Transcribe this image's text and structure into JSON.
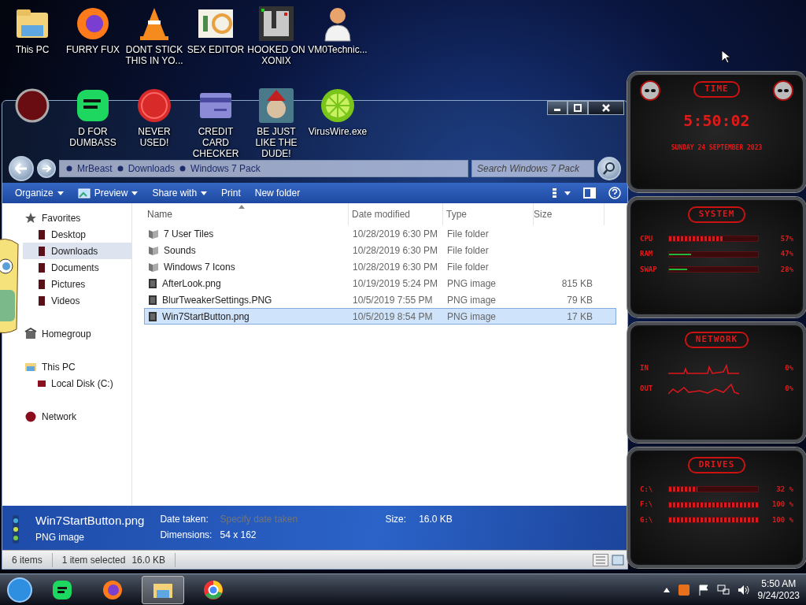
{
  "desktop_icons": [
    {
      "label": "This PC"
    },
    {
      "label": "FURRY FUX"
    },
    {
      "label": "DONT STICK THIS IN YO..."
    },
    {
      "label": "SEX EDITOR"
    },
    {
      "label": "HOOKED ON XONIX"
    },
    {
      "label": "VM0Technic..."
    },
    {
      "label": "D FOR DUMBASS"
    },
    {
      "label": "NEVER USED!"
    },
    {
      "label": "CREDIT CARD CHECKER"
    },
    {
      "label": "BE JUST LIKE THE DUDE!"
    },
    {
      "label": "VirusWire.exe"
    }
  ],
  "explorer": {
    "breadcrumb": [
      "MrBeast",
      "Downloads",
      "Windows 7 Pack"
    ],
    "search": {
      "placeholder": "Search Windows 7 Pack"
    },
    "toolbar": [
      {
        "label": "Organize",
        "dropdown": true
      },
      {
        "label": "Preview",
        "dropdown": true
      },
      {
        "label": "Share with",
        "dropdown": true
      },
      {
        "label": "Print",
        "dropdown": false
      },
      {
        "label": "New folder",
        "dropdown": false
      }
    ],
    "nav": [
      {
        "label": "Favorites",
        "selected": false,
        "children": [
          {
            "label": "Desktop",
            "selected": false
          },
          {
            "label": "Downloads",
            "selected": true
          },
          {
            "label": "Documents",
            "selected": false
          },
          {
            "label": "Pictures",
            "selected": false
          },
          {
            "label": "Videos",
            "selected": false
          }
        ]
      },
      {
        "label": "Homegroup",
        "selected": false
      },
      {
        "label": "This PC",
        "selected": false,
        "children": [
          {
            "label": "Local Disk (C:)",
            "selected": false
          }
        ]
      },
      {
        "label": "Network",
        "selected": false
      }
    ],
    "columns": [
      {
        "label": "Name",
        "sorted": true
      },
      {
        "label": "Date modified",
        "sorted": false
      },
      {
        "label": "Type",
        "sorted": false
      },
      {
        "label": "Size",
        "sorted": false
      }
    ],
    "rows": [
      {
        "kind": "folder",
        "name": "7 User Tiles",
        "date": "10/28/2019 6:30 PM",
        "type": "File folder",
        "selected": false
      },
      {
        "kind": "folder",
        "name": "Sounds",
        "date": "10/28/2019 6:30 PM",
        "type": "File folder",
        "selected": false
      },
      {
        "kind": "folder",
        "name": "Windows 7 Icons",
        "date": "10/28/2019 6:30 PM",
        "type": "File folder",
        "selected": false
      },
      {
        "kind": "file",
        "name": "AfterLook.png",
        "date": "10/19/2019 5:24 PM",
        "type": "PNG image",
        "size": "815 KB",
        "selected": false
      },
      {
        "kind": "file",
        "name": "BlurTweakerSettings.PNG",
        "date": "10/5/2019 7:55 PM",
        "type": "PNG image",
        "size": "79 KB",
        "selected": false
      },
      {
        "kind": "file",
        "name": "Win7StartButton.png",
        "date": "10/5/2019 8:54 PM",
        "type": "PNG image",
        "size": "17 KB",
        "selected": true
      }
    ],
    "details": {
      "name": "Win7StartButton.png",
      "type": "PNG image",
      "date_label": "Date taken:",
      "date_placeholder": "Specify date taken",
      "dim_label": "Dimensions:",
      "dimensions": "54 x 162",
      "size_label": "Size:",
      "size": "16.0 KB"
    },
    "status": {
      "items": "6 items",
      "selected": "1 item selected",
      "selected_size": "16.0 KB"
    }
  },
  "widget": {
    "time": {
      "title": "TIME",
      "clock": "5:50:02",
      "date": "SUNDAY 24 SEPTEMBER 2023"
    },
    "system": {
      "title": "SYSTEM",
      "meters": [
        {
          "label": "CPU",
          "level": 0.6,
          "reading": "57%",
          "color": "#e0161b"
        },
        {
          "label": "RAM",
          "level": 0.25,
          "reading": "47%",
          "color": "#1fb83a"
        },
        {
          "label": "SWAP",
          "level": 0.2,
          "reading": "28%",
          "color": "#1fb83a"
        }
      ]
    },
    "network": {
      "title": "NETWORK",
      "rows": [
        {
          "label": "IN",
          "reading": "0%"
        },
        {
          "label": "OUT",
          "reading": "0%"
        }
      ]
    },
    "drives": {
      "title": "DRIVES",
      "meters": [
        {
          "label": "C:\\",
          "level": 0.32,
          "reading": "32 %"
        },
        {
          "label": "F:\\",
          "level": 1,
          "reading": "100 %"
        },
        {
          "label": "G:\\",
          "level": 1,
          "reading": "100 %"
        }
      ]
    }
  },
  "taskbar": {
    "apps": [
      {
        "selected": false
      },
      {
        "selected": false
      },
      {
        "selected": true
      },
      {
        "selected": false
      }
    ],
    "time": "5:50 AM",
    "date": "9/24/2023"
  }
}
